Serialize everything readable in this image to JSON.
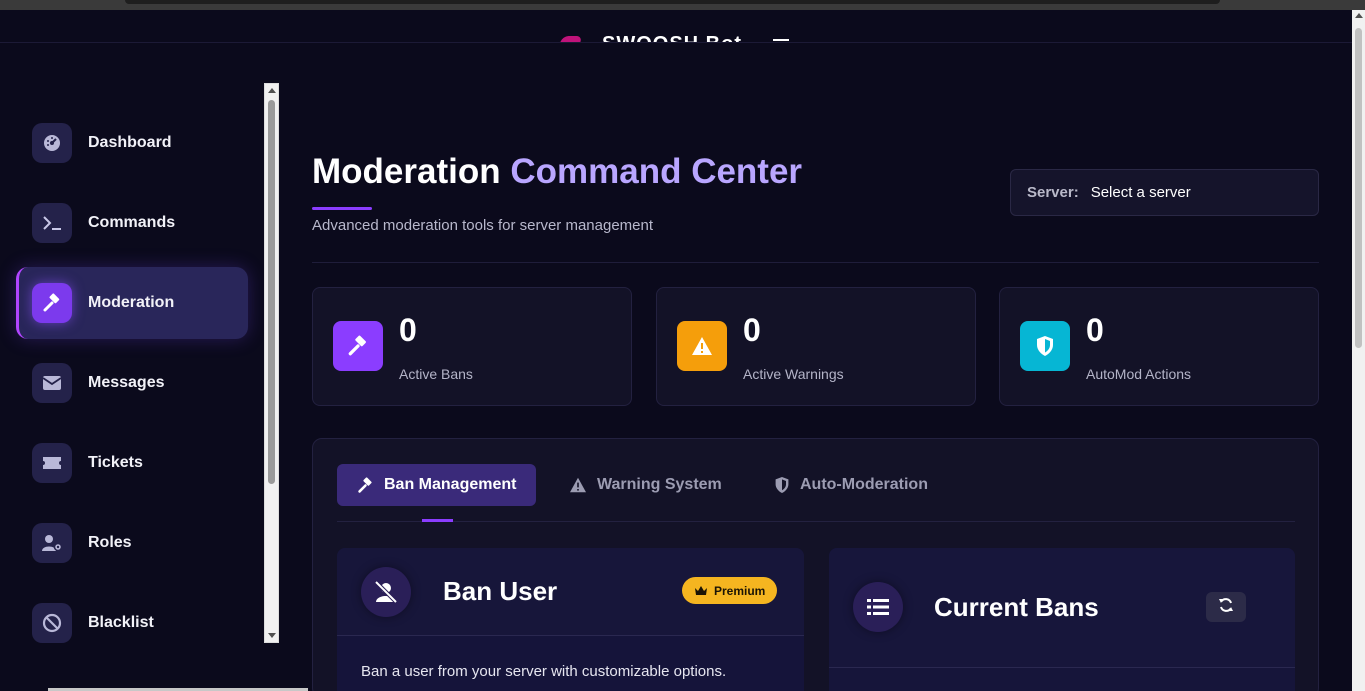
{
  "header": {
    "brand": "SWOOSH Bot"
  },
  "sidebar": {
    "items": [
      {
        "label": "Dashboard",
        "icon": "gauge-icon"
      },
      {
        "label": "Commands",
        "icon": "terminal-icon"
      },
      {
        "label": "Moderation",
        "icon": "gavel-icon",
        "active": true
      },
      {
        "label": "Messages",
        "icon": "envelope-icon"
      },
      {
        "label": "Tickets",
        "icon": "ticket-icon"
      },
      {
        "label": "Roles",
        "icon": "user-gear-icon"
      },
      {
        "label": "Blacklist",
        "icon": "ban-icon"
      }
    ]
  },
  "main": {
    "title_main": "Moderation",
    "title_accent": "Command Center",
    "subtitle": "Advanced moderation tools for server management",
    "server": {
      "label": "Server:",
      "value": "Select a server"
    },
    "stats": [
      {
        "value": "0",
        "label": "Active Bans",
        "color": "#8b3dff",
        "icon": "gavel-icon"
      },
      {
        "value": "0",
        "label": "Active Warnings",
        "color": "#f59e0b",
        "icon": "warning-icon"
      },
      {
        "value": "0",
        "label": "AutoMod Actions",
        "color": "#06b6d4",
        "icon": "shield-icon"
      }
    ],
    "tabs": [
      {
        "label": "Ban Management",
        "icon": "gavel-icon",
        "active": true
      },
      {
        "label": "Warning System",
        "icon": "warning-icon"
      },
      {
        "label": "Auto-Moderation",
        "icon": "shield-icon"
      }
    ],
    "ban_card": {
      "title": "Ban User",
      "badge": "Premium",
      "description": "Ban a user from your server with customizable options."
    },
    "bans_card": {
      "title": "Current Bans"
    }
  }
}
